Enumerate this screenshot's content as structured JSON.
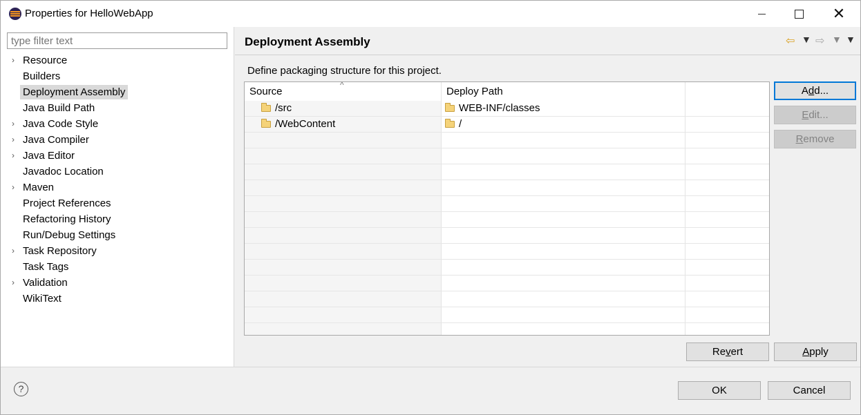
{
  "window": {
    "title": "Properties for HelloWebApp"
  },
  "filter": {
    "placeholder": "type filter text"
  },
  "tree": [
    {
      "label": "Resource",
      "expandable": true,
      "selected": false
    },
    {
      "label": "Builders",
      "expandable": false,
      "selected": false
    },
    {
      "label": "Deployment Assembly",
      "expandable": false,
      "selected": true
    },
    {
      "label": "Java Build Path",
      "expandable": false,
      "selected": false
    },
    {
      "label": "Java Code Style",
      "expandable": true,
      "selected": false
    },
    {
      "label": "Java Compiler",
      "expandable": true,
      "selected": false
    },
    {
      "label": "Java Editor",
      "expandable": true,
      "selected": false
    },
    {
      "label": "Javadoc Location",
      "expandable": false,
      "selected": false
    },
    {
      "label": "Maven",
      "expandable": true,
      "selected": false
    },
    {
      "label": "Project References",
      "expandable": false,
      "selected": false
    },
    {
      "label": "Refactoring History",
      "expandable": false,
      "selected": false
    },
    {
      "label": "Run/Debug Settings",
      "expandable": false,
      "selected": false
    },
    {
      "label": "Task Repository",
      "expandable": true,
      "selected": false
    },
    {
      "label": "Task Tags",
      "expandable": false,
      "selected": false
    },
    {
      "label": "Validation",
      "expandable": true,
      "selected": false
    },
    {
      "label": "WikiText",
      "expandable": false,
      "selected": false
    }
  ],
  "page": {
    "title": "Deployment Assembly",
    "description": "Define packaging structure for this project."
  },
  "table": {
    "columns": [
      "Source",
      "Deploy Path",
      ""
    ],
    "rows": [
      {
        "source": "/src",
        "deploy": "WEB-INF/classes"
      },
      {
        "source": "/WebContent",
        "deploy": "/"
      }
    ],
    "empty_rows": 13
  },
  "buttons": {
    "add": {
      "pre": "A",
      "mn": "d",
      "post": "d..."
    },
    "edit": {
      "pre": "",
      "mn": "E",
      "post": "dit..."
    },
    "remove": {
      "pre": "",
      "mn": "R",
      "post": "emove"
    },
    "revert": {
      "pre": "Re",
      "mn": "v",
      "post": "ert"
    },
    "apply": {
      "pre": "",
      "mn": "A",
      "post": "pply"
    },
    "ok": "OK",
    "cancel": "Cancel"
  },
  "icons": {
    "app": "eclipse-icon",
    "folder": "folder-icon",
    "help": "help-icon"
  },
  "colors": {
    "focus_border": "#0078d7",
    "selected_item_bg": "#d9d9d9",
    "disabled_text": "#838383"
  }
}
